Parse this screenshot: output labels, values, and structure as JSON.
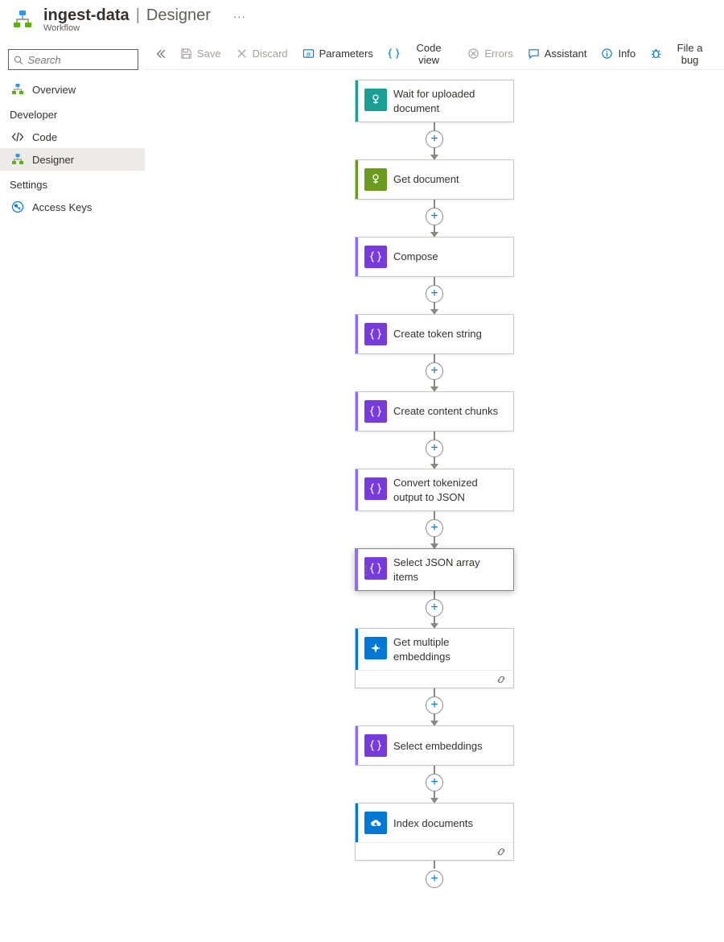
{
  "header": {
    "name": "ingest-data",
    "page": "Designer",
    "subtitle": "Workflow"
  },
  "sidebar": {
    "search_placeholder": "Search",
    "items": [
      {
        "label": "Overview",
        "icon": "workflow"
      }
    ],
    "sections": [
      {
        "title": "Developer",
        "items": [
          {
            "label": "Code",
            "icon": "code"
          },
          {
            "label": "Designer",
            "icon": "workflow",
            "active": true
          }
        ]
      },
      {
        "title": "Settings",
        "items": [
          {
            "label": "Access Keys",
            "icon": "key"
          }
        ]
      }
    ]
  },
  "toolbar": {
    "save": "Save",
    "discard": "Discard",
    "parameters": "Parameters",
    "codeview": "Code view",
    "errors": "Errors",
    "assistant": "Assistant",
    "info": "Info",
    "fileabug": "File a bug"
  },
  "workflow": {
    "nodes": [
      {
        "label": "Wait for uploaded document",
        "accent": "#1b9e93",
        "iconBg": "#1b9e93",
        "iconType": "trigger"
      },
      {
        "label": "Get document",
        "accent": "#6a9b1f",
        "iconBg": "#6a9b1f",
        "iconType": "trigger"
      },
      {
        "label": "Compose",
        "accent": "#8c6cff",
        "iconBg": "#773adc",
        "iconType": "braces"
      },
      {
        "label": "Create token string",
        "accent": "#8c6cff",
        "iconBg": "#773adc",
        "iconType": "braces"
      },
      {
        "label": "Create content chunks",
        "accent": "#8c6cff",
        "iconBg": "#773adc",
        "iconType": "braces"
      },
      {
        "label": "Convert tokenized output to JSON",
        "accent": "#8c6cff",
        "iconBg": "#773adc",
        "iconType": "braces"
      },
      {
        "label": "Select JSON array items",
        "accent": "#8c6cff",
        "iconBg": "#773adc",
        "iconType": "braces",
        "selected": true
      },
      {
        "label": "Get multiple embeddings",
        "accent": "#0078d4",
        "iconBg": "#0078d4",
        "iconType": "sparkle",
        "footer": true
      },
      {
        "label": "Select embeddings",
        "accent": "#8c6cff",
        "iconBg": "#773adc",
        "iconType": "braces"
      },
      {
        "label": "Index documents",
        "accent": "#0078d4",
        "iconBg": "#0078d4",
        "iconType": "cloud",
        "footer": true
      }
    ]
  }
}
